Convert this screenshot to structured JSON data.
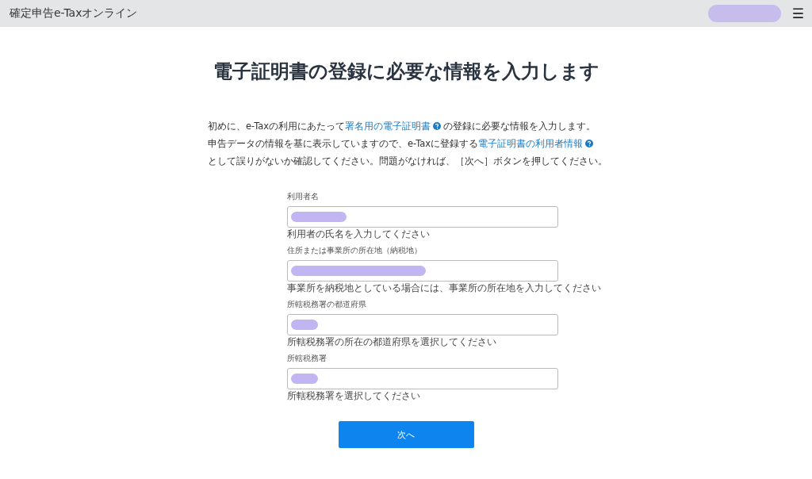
{
  "header": {
    "title": "確定申告e-Taxオンライン",
    "user_redacted": true,
    "menu_icon": "☰"
  },
  "heading": "電子証明書の登録に必要な情報を入力します",
  "intro": [
    {
      "kind": "text",
      "text": "初めに、e-Taxの利用にあたって"
    },
    {
      "kind": "link",
      "text": "署名用の電子証明書"
    },
    {
      "kind": "text",
      "text": "の登録に必要な情報を入力します。"
    },
    {
      "kind": "break"
    },
    {
      "kind": "text",
      "text": "申告データの情報を基に表示していますので、e-Taxに登録する"
    },
    {
      "kind": "link",
      "text": "電子証明書の利用者情報"
    },
    {
      "kind": "break"
    },
    {
      "kind": "text",
      "text": "として誤りがないか確認してください。問題がなければ、［次へ］ボタンを押してください。"
    }
  ],
  "fields": [
    {
      "label": "利用者名",
      "redacted": true,
      "hint": "利用者の氏名を入力してください"
    },
    {
      "label": "住所または事業所の所在地（納税地）",
      "redacted": true,
      "hint": "事業所を納税地としている場合には、事業所の所在地を入力してください"
    },
    {
      "label": "所轄税務署の都道府県",
      "redacted": true,
      "hint": "所轄税務署の所在の都道府県を選択してください"
    },
    {
      "label": "所轄税務署",
      "redacted": true,
      "hint": "所轄税務署を選択してください"
    }
  ],
  "next_button": "次へ"
}
